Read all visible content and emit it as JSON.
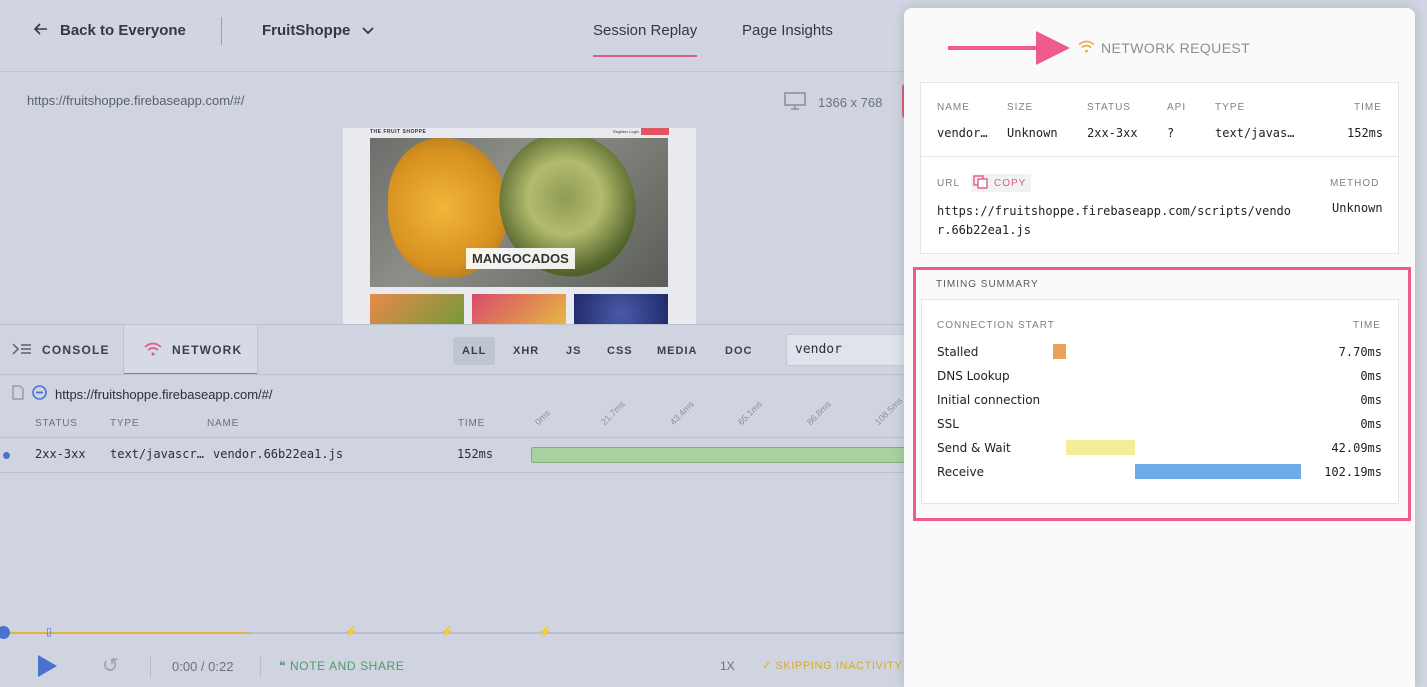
{
  "topbar": {
    "back_label": "Back to Everyone",
    "app_name": "FruitShoppe",
    "tabs": [
      {
        "label": "Session Replay",
        "active": true
      },
      {
        "label": "Page Insights",
        "active": false
      }
    ]
  },
  "replay": {
    "url": "https://fruitshoppe.firebaseapp.com/#/",
    "screen_size": "1366 x 768",
    "preview": {
      "brand": "THE FRUIT SHOPPE",
      "nav": "Register  Login",
      "hero_label": "MANGOCADOS"
    }
  },
  "devtools": {
    "tabs": [
      {
        "label": "CONSOLE",
        "icon": "console-icon",
        "active": false
      },
      {
        "label": "NETWORK",
        "icon": "wifi-icon",
        "active": true
      }
    ],
    "filters": [
      "ALL",
      "XHR",
      "JS",
      "CSS",
      "MEDIA",
      "DOC"
    ],
    "active_filter": "ALL",
    "search_value": "vendor",
    "page_url": "https://fruitshoppe.firebaseapp.com/#/",
    "columns": [
      "STATUS",
      "TYPE",
      "NAME",
      "TIME"
    ],
    "ticks": [
      "0ms",
      "21.7ms",
      "43.4ms",
      "65.1ms",
      "86.8ms",
      "108.5ms"
    ],
    "rows": [
      {
        "status": "2xx-3xx",
        "type": "text/javascr…",
        "name": "vendor.66b22ea1.js",
        "time": "152ms"
      }
    ]
  },
  "player": {
    "time": "0:00 / 0:22",
    "note_label": "NOTE AND SHARE",
    "speed": "1X",
    "skip_label": "✓ SKIPPING INACTIVITY",
    "progress_fraction": 0.0
  },
  "drawer": {
    "title": "NETWORK REQUEST",
    "summary": {
      "headers": [
        "NAME",
        "SIZE",
        "STATUS",
        "API",
        "TYPE",
        "TIME"
      ],
      "values": [
        "vendor…",
        "Unknown",
        "2xx-3xx",
        "?",
        "text/javas…",
        "152ms"
      ]
    },
    "url_label": "URL",
    "copy_label": "COPY",
    "method_label": "METHOD",
    "method_value": "Unknown",
    "url_value": "https://fruitshoppe.firebaseapp.com/scripts/vendor.66b22ea1.js",
    "timing": {
      "title": "TIMING SUMMARY",
      "col_left": "CONNECTION START",
      "col_right": "TIME",
      "rows": [
        {
          "label": "Stalled",
          "value": "7.70ms",
          "color": "#e8a25a"
        },
        {
          "label": "DNS Lookup",
          "value": "0ms"
        },
        {
          "label": "Initial connection",
          "value": "0ms"
        },
        {
          "label": "SSL",
          "value": "0ms"
        },
        {
          "label": "Send & Wait",
          "value": "42.09ms",
          "color": "#f4ee9a"
        },
        {
          "label": "Receive",
          "value": "102.19ms",
          "color": "#6eaae8"
        }
      ]
    }
  },
  "colors": {
    "accent": "#e15c83",
    "play": "#4a72d0",
    "highlight": "#ee5b8c"
  }
}
